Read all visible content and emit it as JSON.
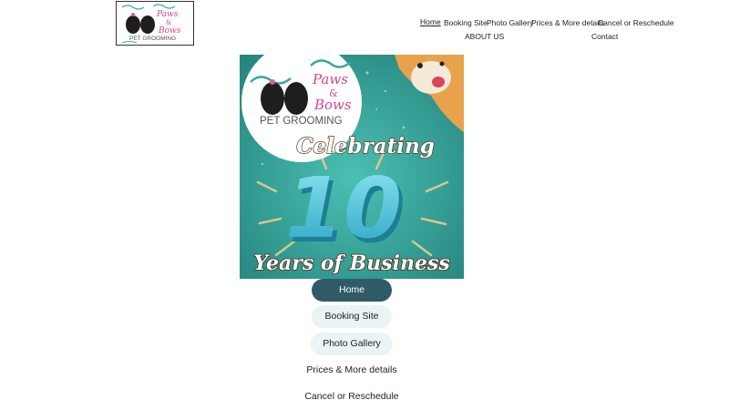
{
  "brand": {
    "logo_line1": "Paws",
    "logo_line2": "&",
    "logo_line3": "Bows",
    "logo_sub": "PET GROOMING"
  },
  "topnav": {
    "items": [
      {
        "label": "Home",
        "active": true
      },
      {
        "label": "Booking Site"
      },
      {
        "label": "Photo Gallery"
      },
      {
        "label": "Prices & More details"
      },
      {
        "label": "Cancel or Reschedule"
      },
      {
        "label": "ABOUT US"
      },
      {
        "label": "Contact"
      }
    ]
  },
  "hero": {
    "headline": "Celebrating",
    "number": "10",
    "tagline": "Years of Business",
    "bg_color": "#2fa39a",
    "accent_color": "#3fb6c9"
  },
  "menu": {
    "items": [
      {
        "label": "Home",
        "style": "active"
      },
      {
        "label": "Booking Site",
        "style": "soft"
      },
      {
        "label": "Photo Gallery",
        "style": "soft"
      },
      {
        "label": "Prices & More details",
        "style": "plain"
      },
      {
        "label": "Cancel or Reschedule",
        "style": "plain"
      }
    ]
  },
  "colors": {
    "active_pill": "#2f5b66",
    "soft_pill": "#eaf3f5",
    "brand_pink": "#d2478f"
  }
}
